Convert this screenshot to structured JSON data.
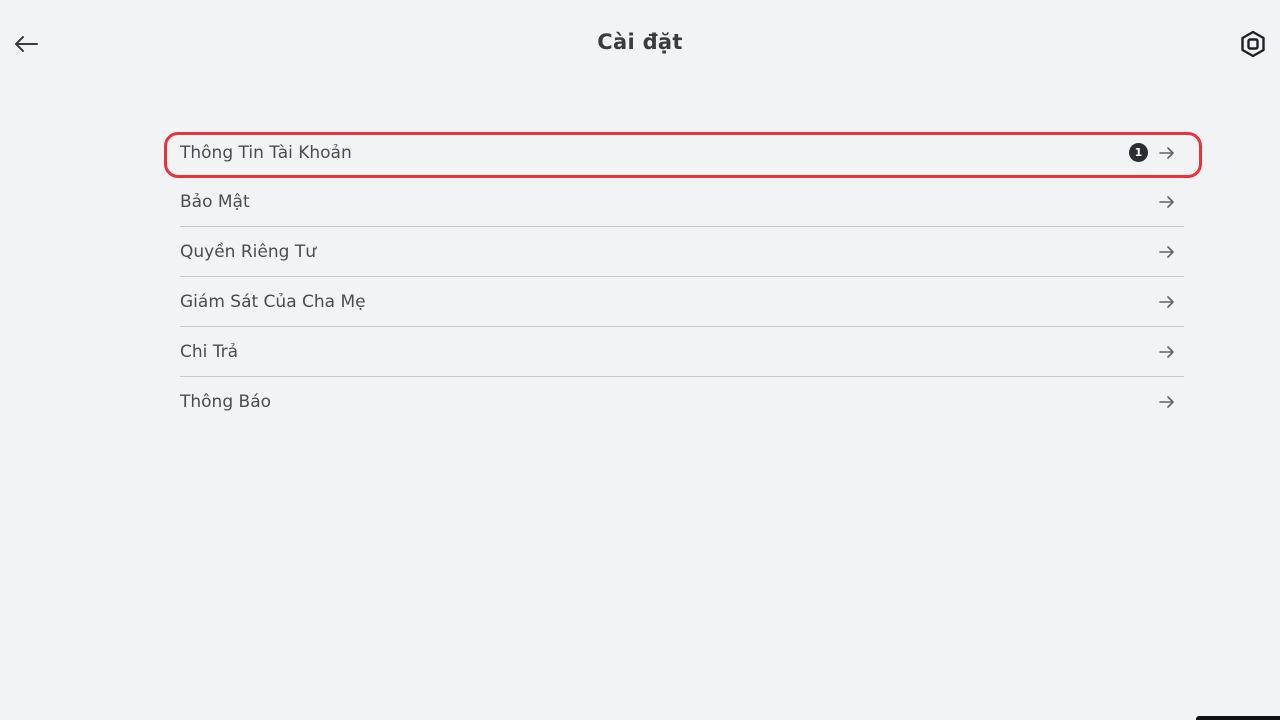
{
  "header": {
    "title": "Cài đặt",
    "back_icon": "arrow-left-icon",
    "currency_icon": "robux-icon"
  },
  "settings": {
    "items": [
      {
        "label": "Thông Tin Tài Khoản",
        "badge": "1",
        "highlighted": true
      },
      {
        "label": "Bảo Mật"
      },
      {
        "label": "Quyền Riêng Tư"
      },
      {
        "label": "Giám Sát Của Cha Mẹ"
      },
      {
        "label": "Chi Trả"
      },
      {
        "label": "Thông Báo"
      }
    ]
  },
  "colors": {
    "background": "#f2f3f5",
    "highlight": "#e8333a",
    "badge": "#2b2d30",
    "divider": "#c8c9cc",
    "text": "#393b3d"
  }
}
